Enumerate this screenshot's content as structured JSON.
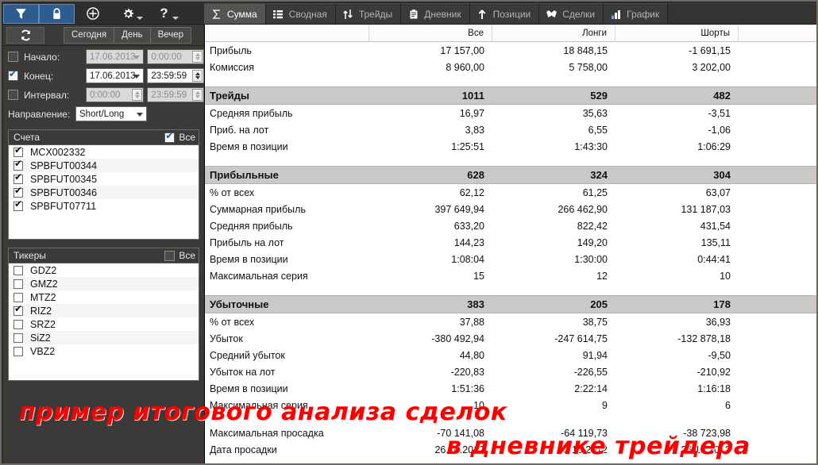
{
  "toolbar_icons": [
    {
      "name": "filter-icon",
      "glyph": "▼",
      "active": true
    },
    {
      "name": "lock-icon",
      "glyph": "🔒",
      "active": true
    },
    {
      "name": "add-icon",
      "glyph": "⊕",
      "active": false
    },
    {
      "name": "settings-icon",
      "glyph": "⚙",
      "active": false
    },
    {
      "name": "help-icon",
      "glyph": "?",
      "active": false
    }
  ],
  "tabs": [
    {
      "label": "Сумма",
      "icon": "sigma-icon",
      "glyph": "Σ",
      "active": true
    },
    {
      "label": "Сводная",
      "icon": "list-icon",
      "glyph": "☰",
      "active": false
    },
    {
      "label": "Трейды",
      "icon": "updown-arrows-icon",
      "glyph": "⇅",
      "active": false
    },
    {
      "label": "Дневник",
      "icon": "clipboard-icon",
      "glyph": "📋",
      "active": false
    },
    {
      "label": "Позиции",
      "icon": "up-arrow-icon",
      "glyph": "↑",
      "active": false
    },
    {
      "label": "Сделки",
      "icon": "handshake-icon",
      "glyph": "♥",
      "active": false
    },
    {
      "label": "График",
      "icon": "bar-chart-icon",
      "glyph": "▮",
      "active": false
    }
  ],
  "toolbar2": {
    "refresh_icon": "refresh-icon",
    "segments": [
      "Сегодня",
      "День",
      "Вечер"
    ]
  },
  "filters": {
    "start": {
      "label": "Начало:",
      "checked": false,
      "date": "17.06.2013",
      "time": "0:00:00"
    },
    "end": {
      "label": "Конец:",
      "checked": true,
      "date": "17.06.2013",
      "time": "23:59:59"
    },
    "interval": {
      "label": "Интервал:",
      "checked": false,
      "from": "0:00:00",
      "to": "23:59:59"
    },
    "direction": {
      "label": "Направление:",
      "value": "Short/Long"
    }
  },
  "accounts": {
    "title": "Счета",
    "all_label": "Все",
    "all_checked": true,
    "items": [
      {
        "name": "MCX002332",
        "checked": true
      },
      {
        "name": "SPBFUT00344",
        "checked": true
      },
      {
        "name": "SPBFUT00345",
        "checked": true
      },
      {
        "name": "SPBFUT00346",
        "checked": true
      },
      {
        "name": "SPBFUT07711",
        "checked": true
      }
    ]
  },
  "tickers": {
    "title": "Тикеры",
    "all_label": "Все",
    "all_checked": false,
    "items": [
      {
        "name": "GDZ2",
        "checked": false
      },
      {
        "name": "GMZ2",
        "checked": false
      },
      {
        "name": "MTZ2",
        "checked": false
      },
      {
        "name": "RIZ2",
        "checked": true
      },
      {
        "name": "SRZ2",
        "checked": false
      },
      {
        "name": "SiZ2",
        "checked": false
      },
      {
        "name": "VBZ2",
        "checked": false
      }
    ]
  },
  "table": {
    "columns": [
      "",
      "Все",
      "Лонги",
      "Шорты"
    ],
    "rows": [
      {
        "type": "data",
        "label": "Прибыль",
        "values": [
          "17 157,00",
          "18 848,15",
          "-1 691,15"
        ],
        "colors": [
          "pos",
          "pos",
          "neg"
        ]
      },
      {
        "type": "data",
        "label": "Комиссия",
        "values": [
          "8 960,00",
          "5 758,00",
          "3 202,00"
        ],
        "colors": [
          "",
          "",
          ""
        ]
      },
      {
        "type": "gap"
      },
      {
        "type": "section",
        "label": "Трейды",
        "values": [
          "1011",
          "529",
          "482"
        ],
        "colors": [
          "",
          "",
          ""
        ]
      },
      {
        "type": "data",
        "label": "Средняя прибыль",
        "values": [
          "16,97",
          "35,63",
          "-3,51"
        ],
        "colors": [
          "pos",
          "pos",
          "neg"
        ]
      },
      {
        "type": "data",
        "label": "Приб. на лот",
        "values": [
          "3,83",
          "6,55",
          "-1,06"
        ],
        "colors": [
          "pos",
          "pos",
          "neg"
        ]
      },
      {
        "type": "data",
        "label": "Время в позиции",
        "values": [
          "1:25:51",
          "1:43:30",
          "1:06:29"
        ],
        "colors": [
          "",
          "",
          ""
        ]
      },
      {
        "type": "gap"
      },
      {
        "type": "section",
        "label": "Прибыльные",
        "values": [
          "628",
          "324",
          "304"
        ],
        "colors": [
          "",
          "",
          ""
        ]
      },
      {
        "type": "data",
        "label": "% от всех",
        "values": [
          "62,12",
          "61,25",
          "63,07"
        ],
        "colors": [
          "",
          "",
          ""
        ]
      },
      {
        "type": "data",
        "label": "Суммарная прибыль",
        "values": [
          "397 649,94",
          "266 462,90",
          "131 187,03"
        ],
        "colors": [
          "pos",
          "pos",
          "pos"
        ]
      },
      {
        "type": "data",
        "label": "Средняя прибыль",
        "values": [
          "633,20",
          "822,42",
          "431,54"
        ],
        "colors": [
          "pos",
          "pos",
          "pos"
        ]
      },
      {
        "type": "data",
        "label": "Прибыль на лот",
        "values": [
          "144,23",
          "149,20",
          "135,11"
        ],
        "colors": [
          "pos",
          "pos",
          "pos"
        ]
      },
      {
        "type": "data",
        "label": "Время в позиции",
        "values": [
          "1:08:04",
          "1:30:00",
          "0:44:41"
        ],
        "colors": [
          "",
          "",
          ""
        ]
      },
      {
        "type": "data",
        "label": "Максимальная серия",
        "values": [
          "15",
          "12",
          "10"
        ],
        "colors": [
          "",
          "",
          ""
        ]
      },
      {
        "type": "gap"
      },
      {
        "type": "section",
        "label": "Убыточные",
        "values": [
          "383",
          "205",
          "178"
        ],
        "colors": [
          "",
          "",
          ""
        ]
      },
      {
        "type": "data",
        "label": "% от всех",
        "values": [
          "37,88",
          "38,75",
          "36,93"
        ],
        "colors": [
          "",
          "",
          ""
        ]
      },
      {
        "type": "data",
        "label": "Убыток",
        "values": [
          "-380 492,94",
          "-247 614,75",
          "-132 878,18"
        ],
        "colors": [
          "neg",
          "neg",
          "neg"
        ]
      },
      {
        "type": "data",
        "label": "Средний убыток",
        "values": [
          "44,80",
          "91,94",
          "-9,50"
        ],
        "colors": [
          "neg",
          "neg",
          "neg"
        ]
      },
      {
        "type": "data",
        "label": "Убыток на лот",
        "values": [
          "-220,83",
          "-226,55",
          "-210,92"
        ],
        "colors": [
          "neg",
          "neg",
          "neg"
        ]
      },
      {
        "type": "data",
        "label": "Время в позиции",
        "values": [
          "1:51:36",
          "2:22:14",
          "1:16:18"
        ],
        "colors": [
          "",
          "",
          ""
        ]
      },
      {
        "type": "data",
        "label": "Максимальная серия",
        "values": [
          "10",
          "9",
          "6"
        ],
        "colors": [
          "",
          "",
          ""
        ]
      },
      {
        "type": "gap"
      },
      {
        "type": "data",
        "label": "Максимальная просадка",
        "values": [
          "-70 141,08",
          "-64 119,73",
          "-38 723,98"
        ],
        "colors": [
          "neg",
          "neg",
          "neg"
        ]
      },
      {
        "type": "data",
        "label": "Дата просадки",
        "values": [
          "26.10.2012",
          "26.10.2012",
          "26.10.2012"
        ],
        "colors": [
          "",
          "",
          ""
        ]
      }
    ]
  },
  "watermark": {
    "line1": "пример итогового анализа сделок",
    "line2": "в дневнике трейдера",
    "color": "#fb0000"
  }
}
